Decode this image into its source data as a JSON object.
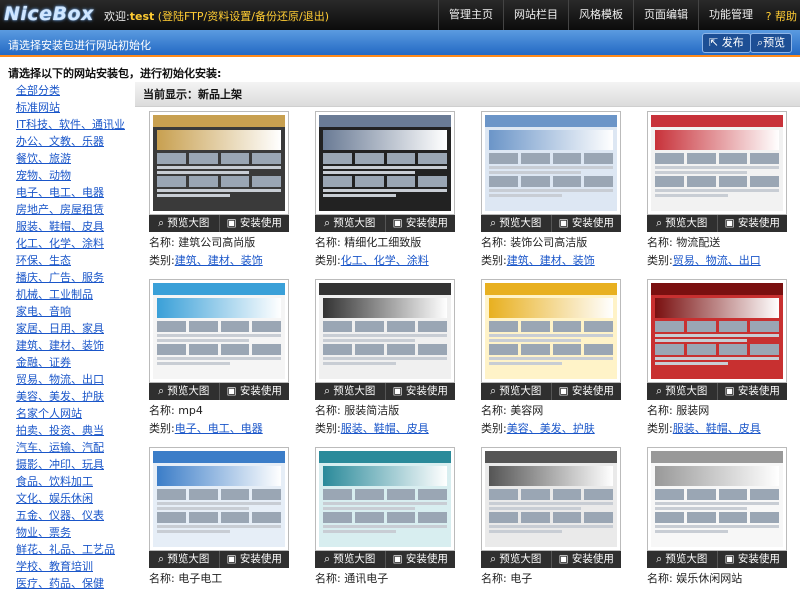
{
  "topbar": {
    "logo": "NiceBox",
    "welcome_prefix": "欢迎:",
    "user": "test",
    "links": [
      "登陆FTP",
      "资料设置",
      "备份还原",
      "退出"
    ],
    "nav": [
      "管理主页",
      "网站栏目",
      "风格模板",
      "页面编辑",
      "功能管理"
    ],
    "help": "? 帮助"
  },
  "bluebar": {
    "title": "请选择安装包进行网站初始化",
    "publish": "发布",
    "preview": "预览"
  },
  "instruction": "请选择以下的网站安装包，进行初始化安装:",
  "sidebar": {
    "categories": [
      "全部分类",
      "标准网站",
      "IT科技、软件、通讯业",
      "办公、文教、乐器",
      "餐饮、旅游",
      "宠物、动物",
      "电子、电工、电器",
      "房地产、房屋租赁",
      "服装、鞋帽、皮具",
      "化工、化学、涂料",
      "环保、生态",
      "播庆、广告、服务",
      "机械、工业制品",
      "家电、音响",
      "家居、日用、家具",
      "建筑、建材、装饰",
      "金融、证券",
      "贸易、物流、出口",
      "美容、美发、护肤",
      "名家个人网站",
      "拍卖、投资、典当",
      "汽车、运输、汽配",
      "摄影、冲印、玩具",
      "食品、饮料加工",
      "文化、娱乐休闲",
      "五金、仪器、仪表",
      "物业、票务",
      "鲜花、礼品、工艺品",
      "学校、教育培训",
      "医疗、药品、保健"
    ]
  },
  "content": {
    "header": "当前显示：新品上架",
    "preview_btn": "预览大图",
    "install_btn": "安装使用",
    "name_label": "名称:",
    "type_label": "类别:",
    "cards": [
      {
        "name": "建筑公司高尚版",
        "category": "建筑、建材、装饰",
        "theme": "#3a3a3a",
        "accent": "#c8a050"
      },
      {
        "name": "精细化工细致版",
        "category": "化工、化学、涂料",
        "theme": "#222222",
        "accent": "#6a7b95"
      },
      {
        "name": "装饰公司高洁版",
        "category": "建筑、建材、装饰",
        "theme": "#dde7f3",
        "accent": "#6b95c8"
      },
      {
        "name": "物流配送",
        "category": "贸易、物流、出口",
        "theme": "#f2f2f2",
        "accent": "#c8323a"
      },
      {
        "name": "mp4",
        "category": "电子、电工、电器",
        "theme": "#f5f5f5",
        "accent": "#3aa0d8"
      },
      {
        "name": "服装简洁版",
        "category": "服装、鞋帽、皮具",
        "theme": "#f0f0f0",
        "accent": "#333333"
      },
      {
        "name": "美容网",
        "category": "美容、美发、护肤",
        "theme": "#fff3c8",
        "accent": "#e8b020"
      },
      {
        "name": "服装网",
        "category": "服装、鞋帽、皮具",
        "theme": "#c83030",
        "accent": "#7a1010"
      },
      {
        "name": "电子电工",
        "category": "",
        "theme": "#e6eef7",
        "accent": "#3b7dc8"
      },
      {
        "name": "通讯电子",
        "category": "",
        "theme": "#d8eef0",
        "accent": "#2a8a9a"
      },
      {
        "name": "电子",
        "category": "",
        "theme": "#eaeaea",
        "accent": "#555555"
      },
      {
        "name": "娱乐休闲网站",
        "category": "",
        "theme": "#f7f7f7",
        "accent": "#999999"
      }
    ]
  }
}
